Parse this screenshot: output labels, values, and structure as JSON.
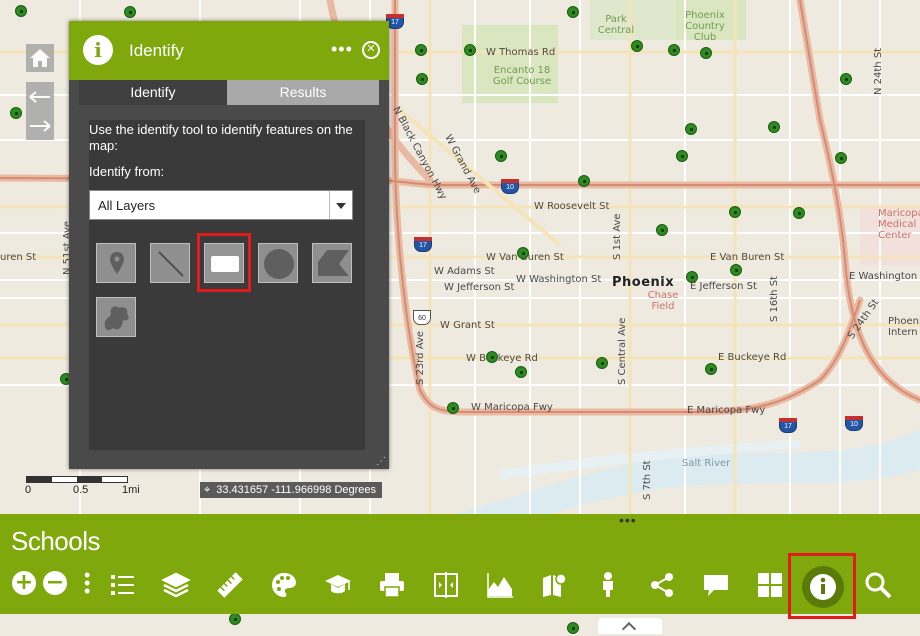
{
  "map": {
    "street_labels": [
      "W Thomas Rd",
      "W Grand Ave",
      "W Roosevelt St",
      "W Van Buren St",
      "E Van Buren St",
      "W Adams St",
      "W Washington St",
      "E Washington St",
      "W Jefferson St",
      "E Jefferson St",
      "W Grant St",
      "W Buckeye Rd",
      "E Buckeye Rd",
      "W Maricopa Fwy",
      "E Maricopa Fwy",
      "N 51st Ave",
      "N Black Canyon Hwy",
      "S 23rd Ave",
      "S Central Ave",
      "S 1st Ave",
      "S 7th St",
      "S 16th St",
      "S 24th St",
      "N 24th St",
      "W Van Buren St"
    ],
    "left_street": "uren St",
    "place_labels": [
      "Park Central",
      "Phoenix Country Club",
      "Encanto 18 Golf Course",
      "Chase Field",
      "Salt River",
      "Maricopa Medical Center",
      "Phoenix Intern"
    ],
    "city_label": "Phoenix",
    "road_shields": [
      "17",
      "10",
      "17",
      "60",
      "17",
      "10"
    ]
  },
  "left_nav": {
    "home_icon": "home-icon",
    "back_icon": "arrow-left-icon",
    "forward_icon": "arrow-right-icon"
  },
  "scale": {
    "labels": [
      "0",
      "0.5",
      "1mi"
    ]
  },
  "coords": {
    "text": "33.431657 -111.966998 Degrees"
  },
  "identify_panel": {
    "title": "Identify",
    "tabs": [
      "Identify",
      "Results"
    ],
    "description": "Use the identify tool to identify features on the map:",
    "from_label": "Identify from:",
    "layer_select": {
      "value": "All Layers"
    },
    "tools": [
      "point-tool",
      "line-tool",
      "extent-tool",
      "circle-tool",
      "polygon-tool",
      "freehand-tool"
    ],
    "selected_tool": "extent-tool"
  },
  "bottom_bar": {
    "title": "Schools",
    "accent": "#7ea80b",
    "toolbar": [
      "legend-icon",
      "layers-icon",
      "measure-icon",
      "basemap-icon",
      "education-icon",
      "print-icon",
      "swipe-icon",
      "elevation-icon",
      "directions-icon",
      "streetview-icon",
      "share-icon",
      "comment-icon",
      "widgets-icon",
      "identify-icon",
      "search-icon"
    ],
    "active_tool": "identify-icon"
  },
  "colors": {
    "highlight": "#e01c1c",
    "school": "#2e8b1f",
    "panel": "#4a4a4a"
  }
}
